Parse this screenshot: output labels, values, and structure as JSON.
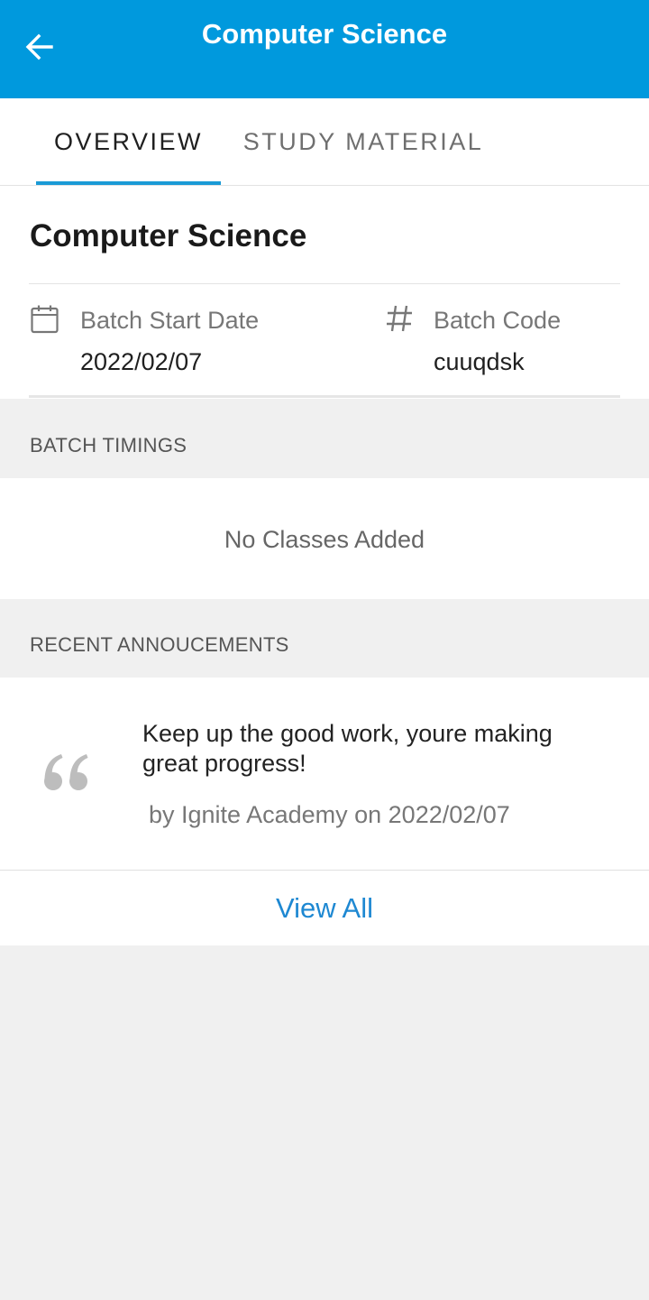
{
  "appbar": {
    "title": "Computer Science",
    "back_icon": "arrow-left-icon"
  },
  "tabs": [
    {
      "label": "OVERVIEW",
      "active": true
    },
    {
      "label": "STUDY MATERIAL",
      "active": false
    }
  ],
  "overview": {
    "course_title": "Computer Science",
    "batch_start": {
      "icon": "calendar-icon",
      "label": "Batch Start Date",
      "value": "2022/02/07"
    },
    "batch_code": {
      "icon": "hash-icon",
      "label": "Batch Code",
      "value": "cuuqdsk"
    }
  },
  "batch_timings": {
    "header": "BATCH TIMINGS",
    "empty_text": "No Classes Added"
  },
  "announcements": {
    "header": "RECENT ANNOUCEMENTS",
    "items": [
      {
        "icon": "quote-icon",
        "message": "Keep up the good work, youre making great progress!",
        "meta": "by Ignite Academy on 2022/02/07"
      }
    ],
    "view_all_label": "View All"
  },
  "colors": {
    "appbar": "#0099dd",
    "tab_indicator": "#1a9ad6",
    "link": "#1e88d2",
    "background": "#f0f0f0"
  }
}
